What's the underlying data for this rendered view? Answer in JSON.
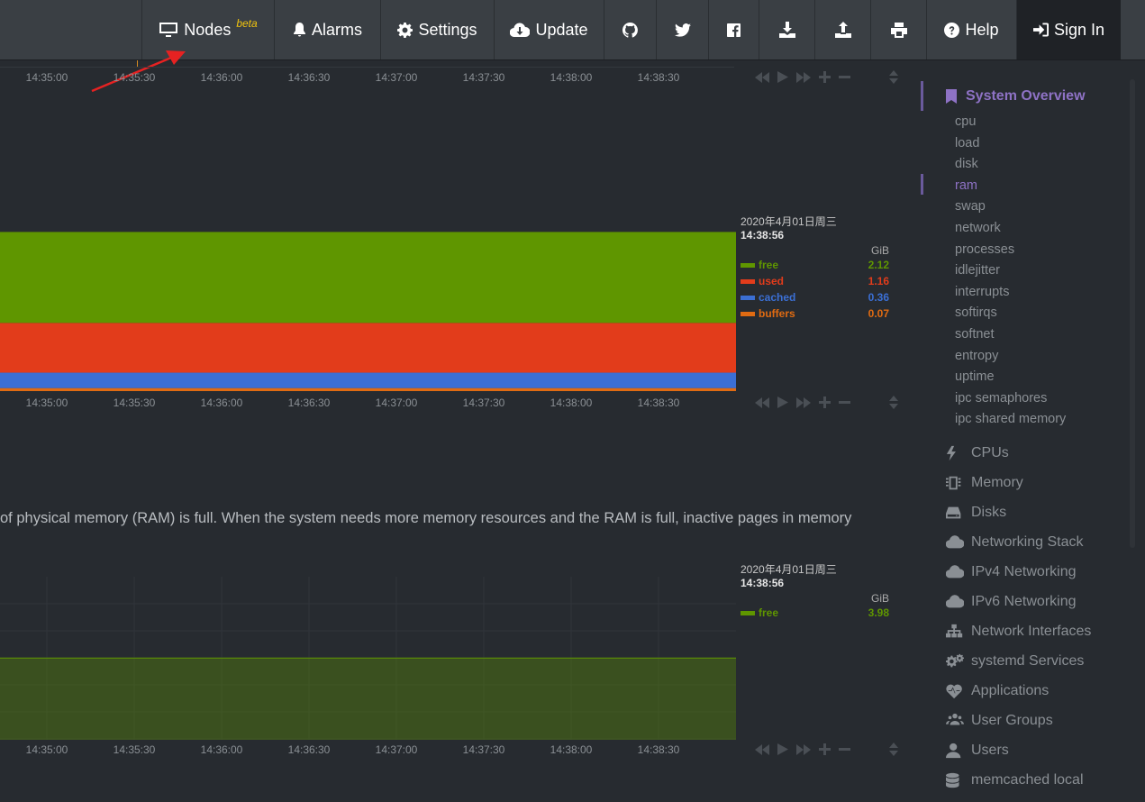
{
  "nav": {
    "nodes_label": "Nodes",
    "nodes_badge": "beta",
    "alarms_label": "Alarms",
    "settings_label": "Settings",
    "update_label": "Update",
    "help_label": "Help",
    "signin_label": "Sign In"
  },
  "time_ticks": [
    "14:35:00",
    "14:35:30",
    "14:36:00",
    "14:36:30",
    "14:37:00",
    "14:37:30",
    "14:38:00",
    "14:38:30"
  ],
  "ram_chart": {
    "date": "2020年4月01日周三",
    "time": "14:38:56",
    "unit": "GiB",
    "legend": [
      {
        "name": "free",
        "value": "2.12",
        "color": "#5f9600"
      },
      {
        "name": "used",
        "value": "1.16",
        "color": "#e23c1b"
      },
      {
        "name": "cached",
        "value": "0.36",
        "color": "#3b6fd4"
      },
      {
        "name": "buffers",
        "value": "0.07",
        "color": "#e06b12"
      }
    ]
  },
  "description": "of physical memory (RAM) is full. When the system needs more memory resources and the RAM is full, inactive pages in memory",
  "swap_chart": {
    "date": "2020年4月01日周三",
    "time": "14:38:56",
    "unit": "GiB",
    "legend": [
      {
        "name": "free",
        "value": "3.98",
        "color": "#5f9600"
      }
    ]
  },
  "sidebar": {
    "title": "System Overview",
    "sub_items": [
      "cpu",
      "load",
      "disk",
      "ram",
      "swap",
      "network",
      "processes",
      "idlejitter",
      "interrupts",
      "softirqs",
      "softnet",
      "entropy",
      "uptime",
      "ipc semaphores",
      "ipc shared memory"
    ],
    "active_sub": "ram",
    "sections": [
      {
        "label": "CPUs",
        "icon": "bolt-icon"
      },
      {
        "label": "Memory",
        "icon": "memory-chip-icon"
      },
      {
        "label": "Disks",
        "icon": "hdd-icon"
      },
      {
        "label": "Networking Stack",
        "icon": "cloud-icon"
      },
      {
        "label": "IPv4 Networking",
        "icon": "cloud-icon"
      },
      {
        "label": "IPv6 Networking",
        "icon": "cloud-icon"
      },
      {
        "label": "Network Interfaces",
        "icon": "sitemap-icon"
      },
      {
        "label": "systemd Services",
        "icon": "gears-icon"
      },
      {
        "label": "Applications",
        "icon": "heartbeat-icon"
      },
      {
        "label": "User Groups",
        "icon": "users-icon"
      },
      {
        "label": "Users",
        "icon": "user-icon"
      },
      {
        "label": "memcached local",
        "icon": "database-icon"
      }
    ]
  },
  "colors": {
    "accent": "#8e72c5",
    "free": "#5f9600",
    "used": "#e23c1b",
    "cached": "#3b6fd4",
    "buffers": "#e06b12"
  }
}
